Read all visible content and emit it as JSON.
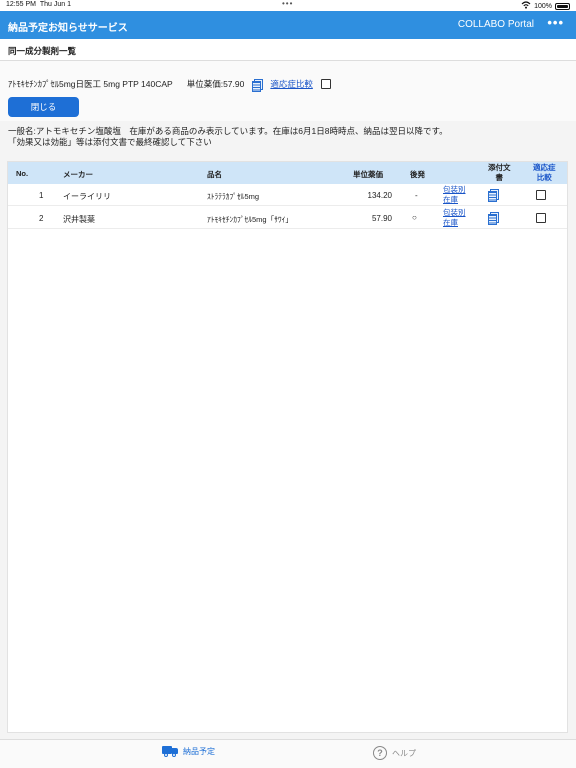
{
  "status": {
    "time": "12:55 PM",
    "date": "Thu Jun 1",
    "battery": "100%"
  },
  "appbar": {
    "title": "納品予定お知らせサービス",
    "portal": "COLLABO Portal",
    "more": "•••"
  },
  "subheader": {
    "title": "同一成分製剤一覧"
  },
  "product": {
    "name": "ｱﾄﾓｷｾﾁﾝｶﾌﾟｾﾙ5mg日医工 5mg PTP 140CAP",
    "price": "単位薬価:57.90",
    "compare_link": "適応症比較",
    "close_button": "閉じる"
  },
  "notice": {
    "line1": "一般名:アトモキセチン塩酸塩　在庫がある商品のみ表示しています。在庫は6月1日8時時点、納品は翌日以降です。",
    "line2": "「効果又は効能」等は添付文書で最終確認して下さい"
  },
  "table": {
    "headers": {
      "no": "No.",
      "maker": "メーカー",
      "name": "品名",
      "price": "単位薬価",
      "generic": "後発",
      "doc_line1": "添付文",
      "doc_line2": "書",
      "compare_line1": "適応症",
      "compare_line2": "比較"
    },
    "rows": [
      {
        "no": "1",
        "maker": "イーライリリ",
        "name": "ｽﾄﾗﾃﾗｶﾌﾟｾﾙ5mg",
        "price": "134.20",
        "generic": "-",
        "pkg_line1": "包装別",
        "pkg_line2": "在庫"
      },
      {
        "no": "2",
        "maker": "沢井製薬",
        "name": "ｱﾄﾓｷｾﾁﾝｶﾌﾟｾﾙ5mg「ｻﾜｲ」",
        "price": "57.90",
        "generic": "○",
        "pkg_line1": "包装別",
        "pkg_line2": "在庫"
      }
    ]
  },
  "tabbar": {
    "delivery": "納品予定",
    "help": "ヘルプ",
    "help_glyph": "?"
  },
  "colors": {
    "appbar": "#2f8fe0",
    "button": "#1e6fd6",
    "table_header": "#cfe5f8",
    "link": "#1a55c8"
  }
}
